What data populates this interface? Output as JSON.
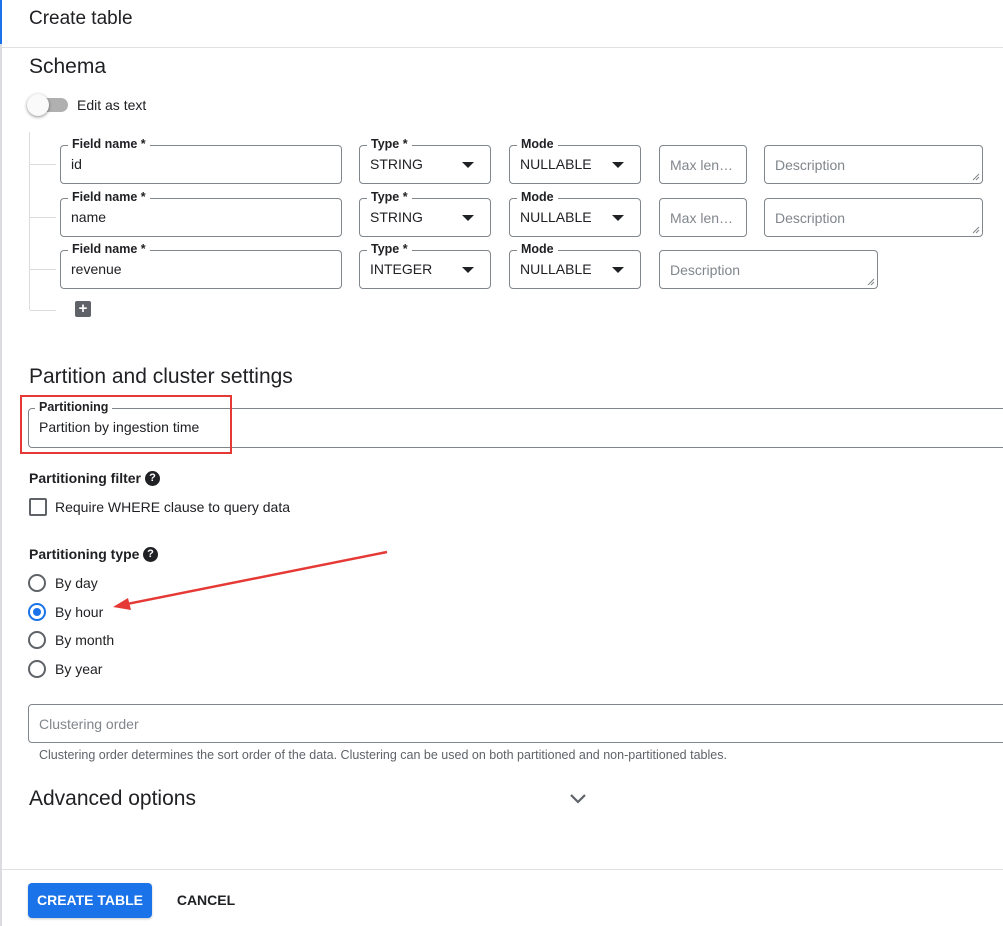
{
  "header": {
    "title": "Create table"
  },
  "schema": {
    "title": "Schema",
    "edit_as_text_label": "Edit as text",
    "fields": [
      {
        "name_label": "Field name *",
        "name_value": "id",
        "type_label": "Type *",
        "type_value": "STRING",
        "mode_label": "Mode",
        "mode_value": "NULLABLE",
        "max_length_placeholder": "Max len…",
        "description_placeholder": "Description"
      },
      {
        "name_label": "Field name *",
        "name_value": "name",
        "type_label": "Type *",
        "type_value": "STRING",
        "mode_label": "Mode",
        "mode_value": "NULLABLE",
        "max_length_placeholder": "Max len…",
        "description_placeholder": "Description"
      },
      {
        "name_label": "Field name *",
        "name_value": "revenue",
        "type_label": "Type *",
        "type_value": "INTEGER",
        "mode_label": "Mode",
        "mode_value": "NULLABLE",
        "description_placeholder": "Description"
      }
    ],
    "add_field_icon": "plus-box-icon"
  },
  "partition": {
    "title": "Partition and cluster settings",
    "partitioning_label": "Partitioning",
    "partitioning_value": "Partition by ingestion time",
    "filter_label": "Partitioning filter",
    "filter_checkbox_label": "Require WHERE clause to query data",
    "filter_checked": false,
    "type_label": "Partitioning type",
    "type_options": [
      "By day",
      "By hour",
      "By month",
      "By year"
    ],
    "type_selected": "By hour",
    "clustering_placeholder": "Clustering order",
    "clustering_hint": "Clustering order determines the sort order of the data. Clustering can be used on both partitioned and non-partitioned tables."
  },
  "advanced": {
    "title": "Advanced options",
    "expand_icon": "chevron-down-icon"
  },
  "footer": {
    "create_label": "CREATE TABLE",
    "cancel_label": "CANCEL"
  },
  "colors": {
    "accent": "#1a73e8",
    "annotation": "#e53935"
  }
}
